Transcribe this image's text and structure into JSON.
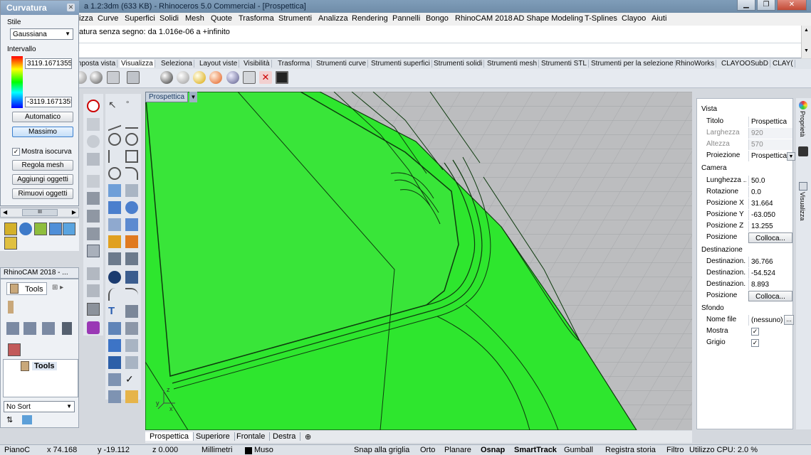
{
  "window": {
    "title_partial": "a 1.2:3dm (633 KB) - Rhinoceros 5.0 Commercial - [Prospettica]",
    "minimize_icon": "minimize-icon",
    "maximize_icon": "restore-icon",
    "close_icon": "close-icon"
  },
  "menu": [
    "izza",
    "Curve",
    "Superfici",
    "Solidi",
    "Mesh",
    "Quote",
    "Trasforma",
    "Strumenti",
    "Analizza",
    "Rendering",
    "Pannelli",
    "Bongo",
    "RhinoCAM 2018",
    "AD Shape Modeling",
    "T-Splines",
    "Clayoo",
    "Aiuti"
  ],
  "command": {
    "history_line": "atura senza segno: da 1.016e-06 a +infinito"
  },
  "toolbar_tabs": [
    "mposta vista",
    "Visualizza",
    "Seleziona",
    "Layout viste",
    "Visibilità",
    "Trasforma",
    "Strumenti curve",
    "Strumenti superfici",
    "Strumenti solidi",
    "Strumenti mesh",
    "Strumenti STL",
    "Strumenti per la selezione",
    "RhinoWorks",
    "CLAYOOSubD",
    "CLAY("
  ],
  "toolbar_active_tab": "Visualizza",
  "curvature_panel": {
    "title": "Curvatura",
    "style_label": "Stile",
    "style_value": "Gaussiana",
    "range_label": "Intervallo",
    "max_value": "3119.1671355",
    "min_value": "-3119.1671355",
    "auto_button": "Automatico",
    "max_button": "Massimo",
    "show_isocurves_label": "Mostra isocurva",
    "show_isocurves_checked": true,
    "adjust_mesh_button": "Regola mesh",
    "add_objects_button": "Aggiungi oggetti",
    "remove_objects_button": "Rimuovi oggetti",
    "scroll_grip": "III"
  },
  "rhinocam_panel": {
    "title": "RhinoCAM 2018 - ...",
    "tools_tab": "Tools",
    "tree_node": "Tools",
    "sort_value": "No Sort"
  },
  "viewport": {
    "label": "Prospettica",
    "tabs": [
      "Prospettica",
      "Superiore",
      "Frontale",
      "Destra"
    ],
    "active_tab": "Prospettica",
    "axis_x": "x",
    "axis_y": "y",
    "axis_z": "z",
    "surface_color": "#2ee62e"
  },
  "properties": {
    "section_view": "Vista",
    "title_label": "Titolo",
    "title_value": "Prospettica",
    "width_label": "Larghezza",
    "width_value": "920",
    "height_label": "Altezza",
    "height_value": "570",
    "projection_label": "Proiezione",
    "projection_value": "Prospettica",
    "section_camera": "Camera",
    "lens_label": "Lunghezza ...",
    "lens_value": "50.0",
    "rotation_label": "Rotazione",
    "rotation_value": "0.0",
    "posx_label": "Posizione X",
    "posx_value": "31.664",
    "posy_label": "Posizione Y",
    "posy_value": "-63.050",
    "posz_label": "Posizione Z",
    "posz_value": "13.255",
    "position_label": "Posizione",
    "place_button": "Colloca...",
    "section_target": "Destinazione",
    "target1_label": "Destinazion...",
    "target1_value": "36.766",
    "target2_label": "Destinazion...",
    "target2_value": "-54.524",
    "target3_label": "Destinazion...",
    "target3_value": "8.893",
    "target_position_label": "Posizione",
    "target_place_button": "Colloca...",
    "section_background": "Sfondo",
    "filename_label": "Nome file",
    "filename_value": "(nessuno)",
    "browse_button": "...",
    "show_label": "Mostra",
    "gray_label": "Grigio",
    "side_tab_props": "Proprietà",
    "side_tab_view": "Visualizza"
  },
  "status": {
    "cplane": "PianoC",
    "x": "x 74.168",
    "y": "y -19.112",
    "z": "z 0.000",
    "units": "Millimetri",
    "layer": "Muso",
    "snap_grid": "Snap alla griglia",
    "ortho": "Orto",
    "planar": "Planare",
    "osnap": "Osnap",
    "smarttrack": "SmartTrack",
    "gumball": "Gumball",
    "record_history": "Registra storia",
    "filter": "Filtro",
    "cpu": "Utilizzo CPU: 2.0 %"
  }
}
